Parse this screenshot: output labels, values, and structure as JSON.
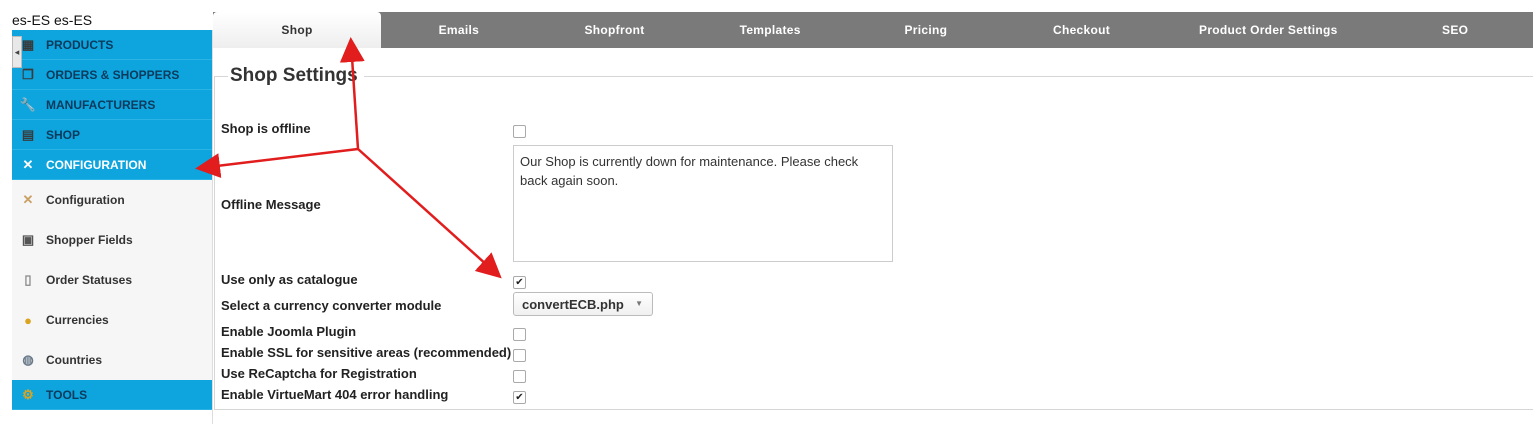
{
  "lang_label": "es-ES es-ES",
  "sidebar": {
    "top_items": [
      {
        "label": "PRODUCTS",
        "icon": "products-icon"
      },
      {
        "label": "ORDERS & SHOPPERS",
        "icon": "orders-icon"
      },
      {
        "label": "MANUFACTURERS",
        "icon": "wrench-icon"
      },
      {
        "label": "SHOP",
        "icon": "shop-icon"
      },
      {
        "label": "CONFIGURATION",
        "icon": "configuration-icon"
      }
    ],
    "sub_items": [
      {
        "label": "Configuration",
        "icon": "tools-cross-icon"
      },
      {
        "label": "Shopper Fields",
        "icon": "form-icon"
      },
      {
        "label": "Order Statuses",
        "icon": "document-icon"
      },
      {
        "label": "Currencies",
        "icon": "coins-icon"
      },
      {
        "label": "Countries",
        "icon": "globe-icon"
      }
    ],
    "bottom_item": {
      "label": "TOOLS",
      "icon": "gear-icon"
    }
  },
  "tabs": [
    "Shop",
    "Emails",
    "Shopfront",
    "Templates",
    "Pricing",
    "Checkout",
    "Product Order Settings",
    "SEO"
  ],
  "legend": "Shop Settings",
  "fields": {
    "shop_offline": {
      "label": "Shop is offline",
      "checked": false
    },
    "offline_message": {
      "label": "Offline Message",
      "value": "Our Shop is currently down for maintenance. Please check back again soon."
    },
    "use_catalogue": {
      "label": "Use only as catalogue",
      "checked": true
    },
    "currency_converter": {
      "label": "Select a currency converter module",
      "value": "convertECB.php"
    },
    "joomla_plugin": {
      "label": "Enable Joomla Plugin",
      "checked": false
    },
    "ssl": {
      "label": "Enable SSL for sensitive areas (recommended)",
      "checked": false
    },
    "recaptcha": {
      "label": "Use ReCaptcha for Registration",
      "checked": false
    },
    "error404": {
      "label": "Enable VirtueMart 404 error handling",
      "checked": true
    }
  },
  "colors": {
    "sidebar_blue": "#0ea5de",
    "tabbar": "#7a7a7a",
    "annotation_arrow": "#e11d1d"
  }
}
